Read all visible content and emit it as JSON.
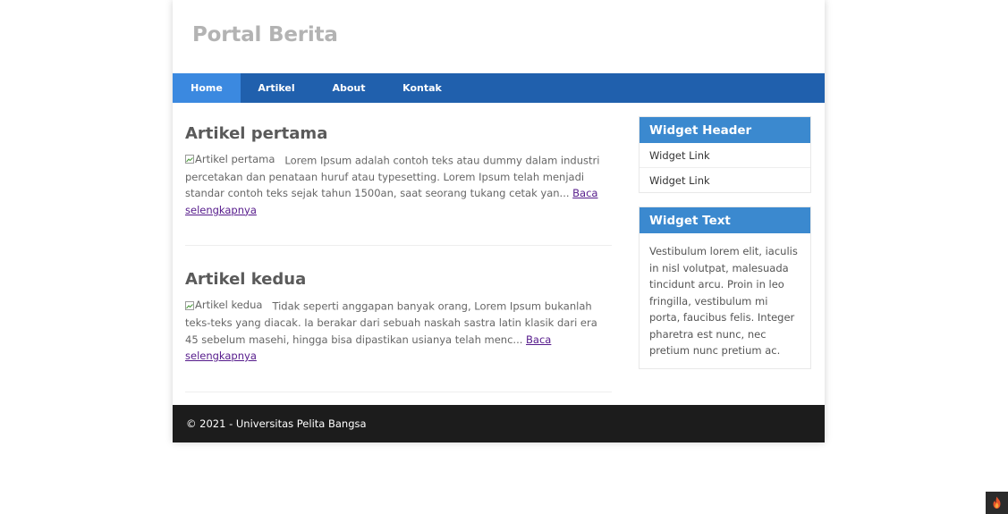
{
  "site": {
    "title": "Portal Berita"
  },
  "nav": {
    "items": [
      {
        "label": "Home",
        "active": true
      },
      {
        "label": "Artikel",
        "active": false
      },
      {
        "label": "About",
        "active": false
      },
      {
        "label": "Kontak",
        "active": false
      }
    ]
  },
  "articles": [
    {
      "title": "Artikel pertama",
      "image_alt": "Artikel pertama",
      "excerpt": "Lorem Ipsum adalah contoh teks atau dummy dalam industri percetakan dan penataan huruf atau typesetting. Lorem Ipsum telah menjadi standar contoh teks sejak tahun 1500an, saat seorang tukang cetak yan...",
      "read_more": "Baca selengkapnya"
    },
    {
      "title": "Artikel kedua",
      "image_alt": "Artikel kedua",
      "excerpt": "Tidak seperti anggapan banyak orang, Lorem Ipsum bukanlah teks-teks yang diacak. Ia berakar dari sebuah naskah sastra latin klasik dari era 45 sebelum masehi, hingga bisa dipastikan usianya telah menc...",
      "read_more": "Baca selengkapnya"
    }
  ],
  "sidebar": {
    "widget_links": {
      "header": "Widget Header",
      "links": [
        "Widget Link",
        "Widget Link"
      ]
    },
    "widget_text": {
      "header": "Widget Text",
      "body": "Vestibulum lorem elit, iaculis in nisl volutpat, malesuada tincidunt arcu. Proin in leo fringilla, vestibulum mi porta, faucibus felis. Integer pharetra est nunc, nec pretium nunc pretium ac."
    }
  },
  "footer": {
    "text": "© 2021 - Universitas Pelita Bangsa"
  },
  "colors": {
    "nav_bg": "#2060ad",
    "nav_active": "#3b89e0",
    "widget_header": "#3b89cf",
    "footer_bg": "#1c1c1c",
    "title_gray": "#b3b3b3",
    "link_visited": "#551a8b"
  },
  "icons": {
    "broken_image": "broken-image-icon",
    "debug_badge": "flame-icon"
  }
}
